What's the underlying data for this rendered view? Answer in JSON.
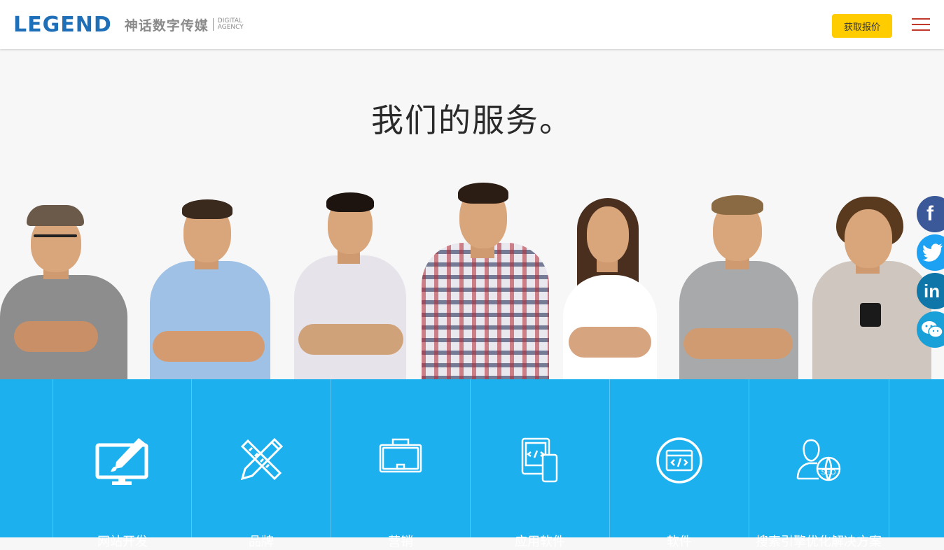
{
  "brand": {
    "logo_text": "LEGEND",
    "cn_name": "神话数字传媒",
    "en_line1": "DIGITAL",
    "en_line2": "AGENCY"
  },
  "header": {
    "quote_button": "获取报价",
    "menu_icon": "hamburger-menu-icon"
  },
  "section": {
    "title": "我们的服务。"
  },
  "people_image": {
    "description_icon": "team-photo"
  },
  "services": [
    {
      "label": "网站开发",
      "icon": "monitor-pen-icon"
    },
    {
      "label": "品牌",
      "icon": "pencil-ruler-icon"
    },
    {
      "label": "营销",
      "icon": "briefcase-icon"
    },
    {
      "label": "应用软件",
      "icon": "tablet-phone-code-icon"
    },
    {
      "label": "软件",
      "icon": "browser-code-icon"
    },
    {
      "label": "搜索引擎优化解决方案",
      "icon": "user-globe-seo-icon"
    }
  ],
  "social": [
    {
      "name": "facebook-icon",
      "glyph": "f",
      "color": "#3b5998"
    },
    {
      "name": "twitter-icon",
      "glyph": "t",
      "color": "#1da1f2"
    },
    {
      "name": "linkedin-icon",
      "glyph": "in",
      "color": "#0e76a8"
    },
    {
      "name": "wechat-icon",
      "glyph": "wx",
      "color": "#1aa0d8"
    }
  ],
  "colors": {
    "accent_yellow": "#ffcc00",
    "services_blue": "#1cb0ef",
    "brand_blue": "#1e6fb8",
    "menu_red": "#c0392b"
  }
}
